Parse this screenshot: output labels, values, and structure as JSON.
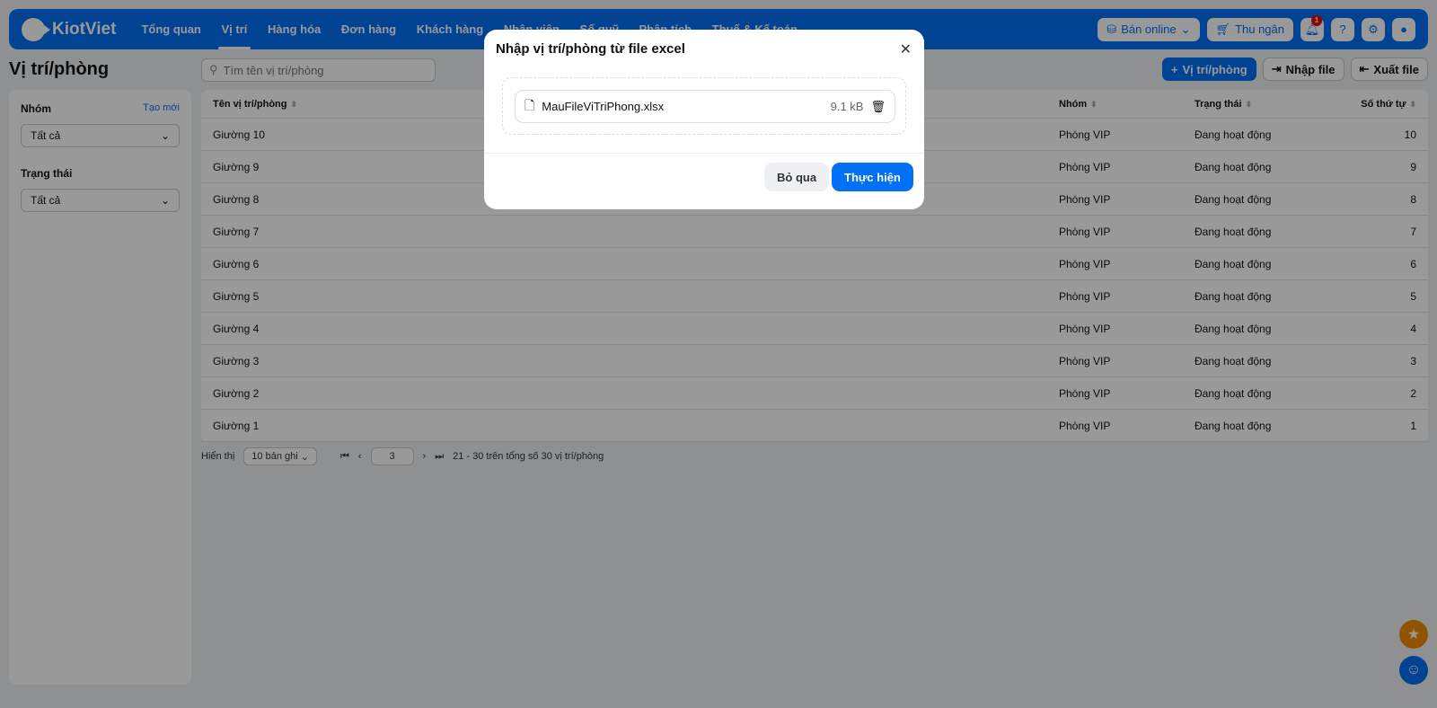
{
  "app": {
    "brand": "KiotViet",
    "nav": [
      "Tổng quan",
      "Vị trí",
      "Hàng hóa",
      "Đơn hàng",
      "Khách hàng",
      "Nhân viên",
      "Sổ quỹ",
      "Phân tích",
      "Thuế & Kế toán"
    ],
    "online": "Bán online",
    "cashier": "Thu ngân",
    "notif_count": "1"
  },
  "page": {
    "title": "Vị trí/phòng",
    "search_placeholder": "Tìm tên vị trí/phòng",
    "add": "Vị trí/phòng",
    "import": "Nhập file",
    "export": "Xuất file"
  },
  "sidebar": {
    "group_label": "Nhóm",
    "create": "Tạo mới",
    "group_value": "Tất cả",
    "status_label": "Trạng thái",
    "status_value": "Tất cả"
  },
  "table": {
    "headers": [
      "Tên vị trí/phòng",
      "Nhóm",
      "Trạng thái",
      "Số thứ tự"
    ],
    "rows": [
      [
        "Giường 10",
        "Phòng VIP",
        "Đang hoạt động",
        "10"
      ],
      [
        "Giường 9",
        "Phòng VIP",
        "Đang hoạt động",
        "9"
      ],
      [
        "Giường 8",
        "Phòng VIP",
        "Đang hoạt động",
        "8"
      ],
      [
        "Giường 7",
        "Phòng VIP",
        "Đang hoạt động",
        "7"
      ],
      [
        "Giường 6",
        "Phòng VIP",
        "Đang hoạt động",
        "6"
      ],
      [
        "Giường 5",
        "Phòng VIP",
        "Đang hoạt động",
        "5"
      ],
      [
        "Giường 4",
        "Phòng VIP",
        "Đang hoạt động",
        "4"
      ],
      [
        "Giường 3",
        "Phòng VIP",
        "Đang hoạt động",
        "3"
      ],
      [
        "Giường 2",
        "Phòng VIP",
        "Đang hoạt động",
        "2"
      ],
      [
        "Giường 1",
        "Phòng VIP",
        "Đang hoạt động",
        "1"
      ]
    ]
  },
  "pager": {
    "show": "Hiển thị",
    "per_page": "10 bản ghi",
    "page": "3",
    "summary": "21 - 30 trên tổng số 30 vị trí/phòng"
  },
  "modal": {
    "title": "Nhập vị trí/phòng từ file excel",
    "file_name": "MauFileViTriPhong.xlsx",
    "file_size": "9.1 kB",
    "cancel": "Bỏ qua",
    "submit": "Thực hiện"
  }
}
